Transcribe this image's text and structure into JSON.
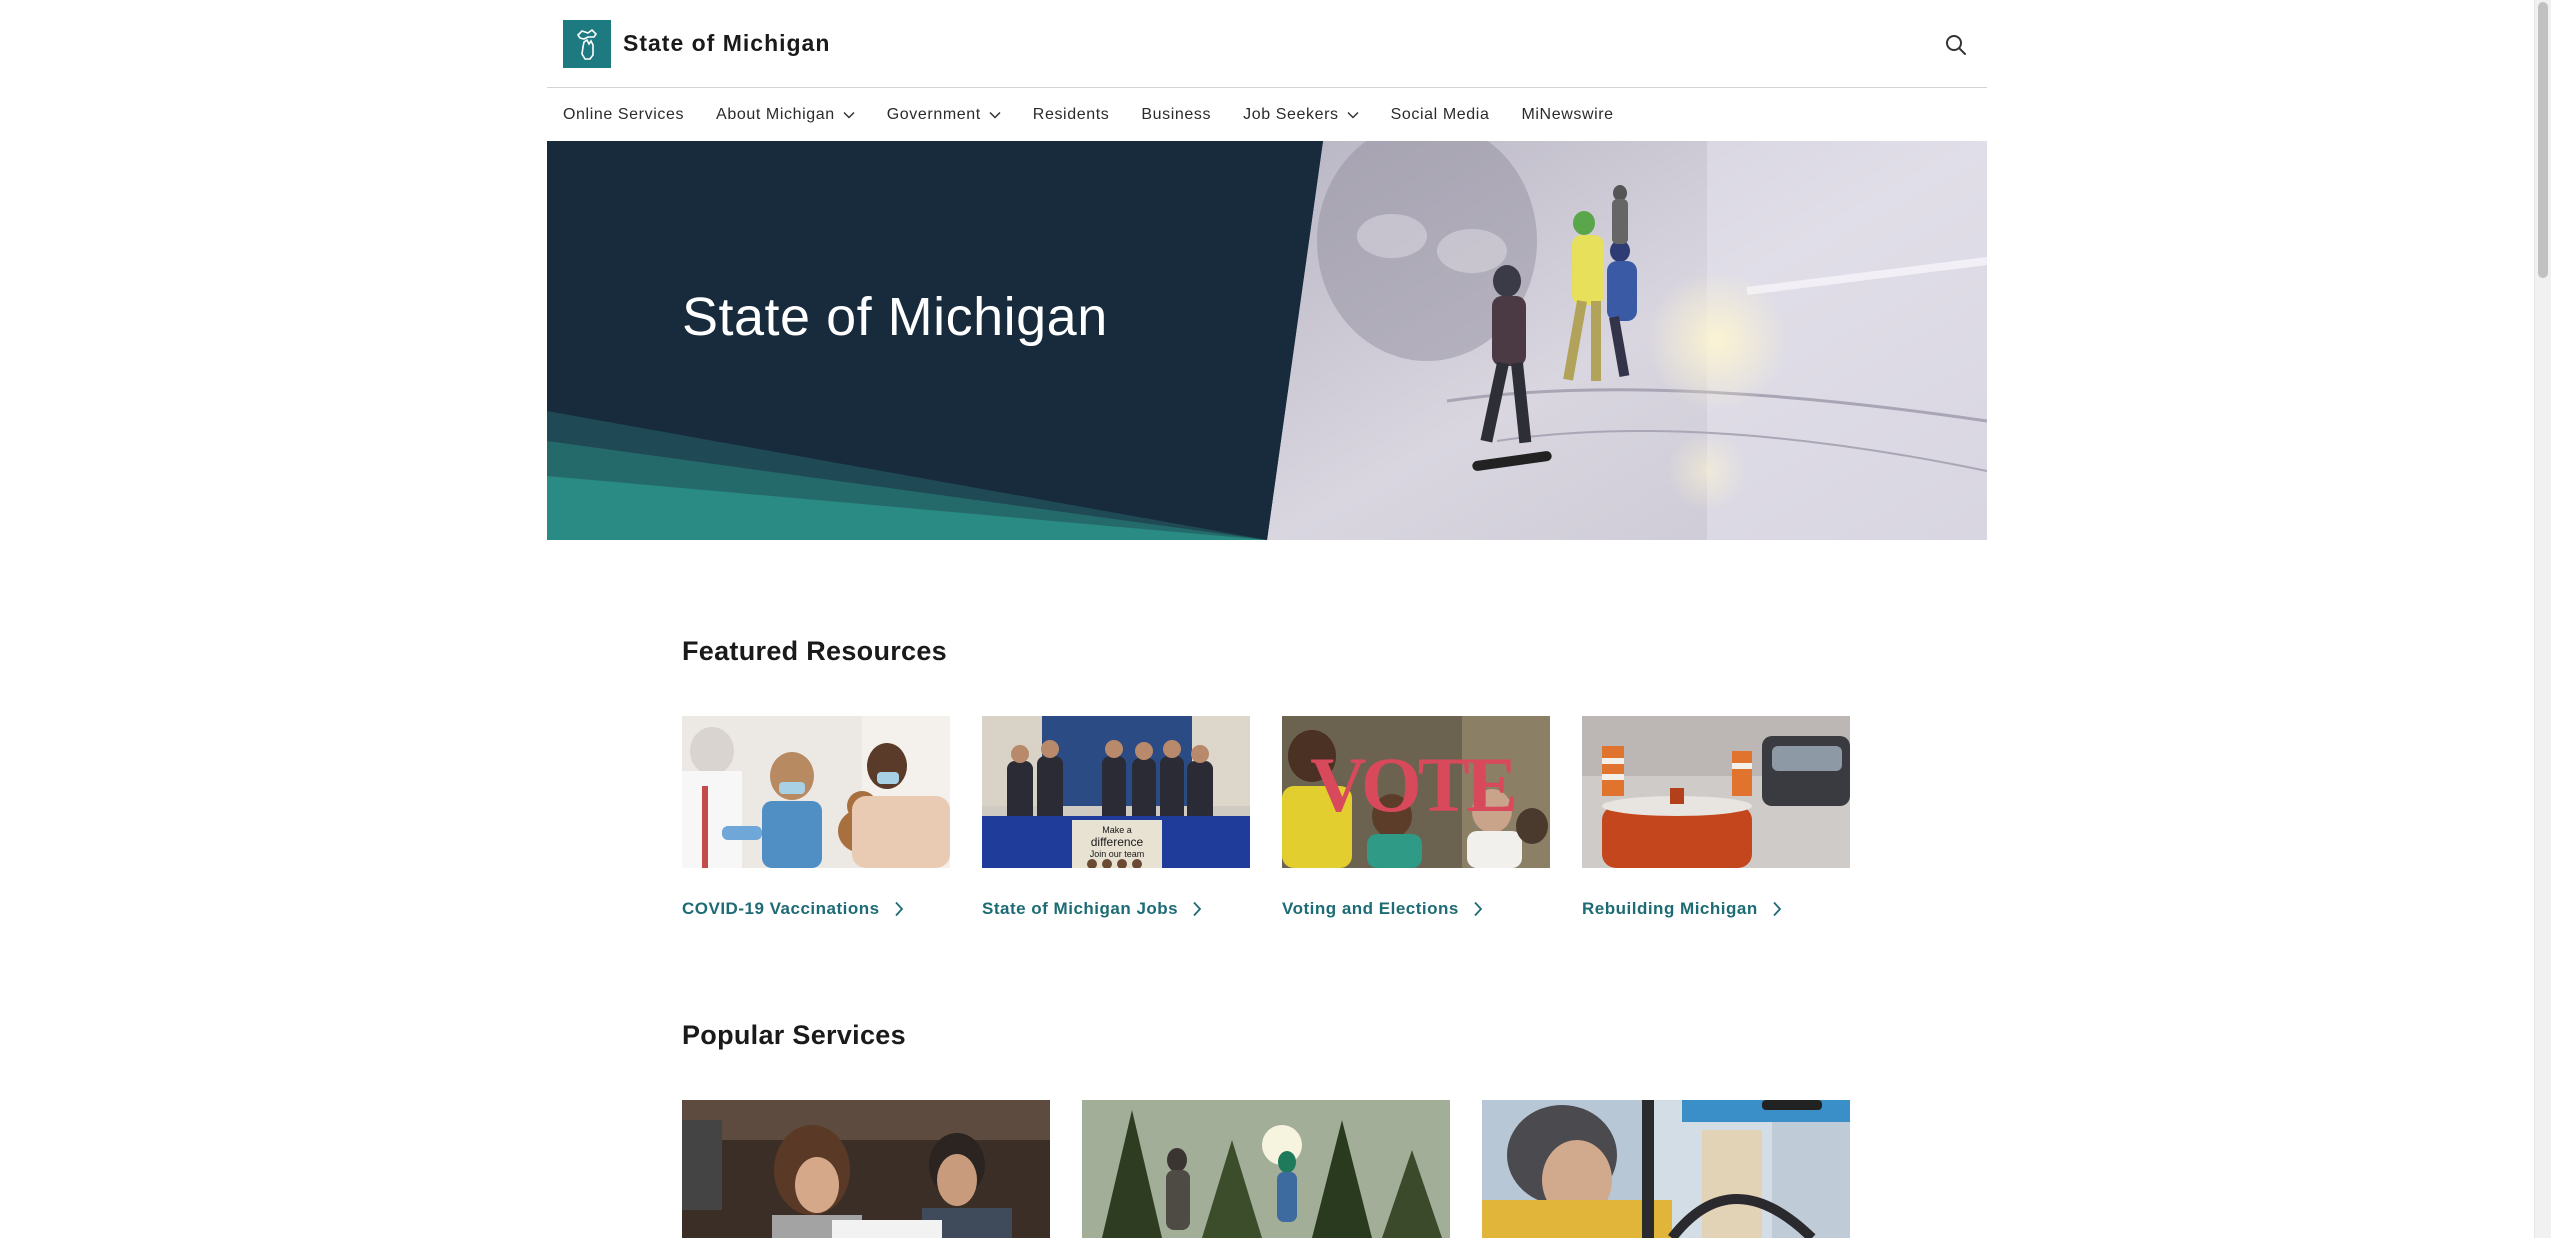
{
  "header": {
    "site_title": "State of Michigan",
    "logo_icon": "michigan-state-logo",
    "search_icon": "search-icon"
  },
  "nav": {
    "items": [
      {
        "label": "Online Services",
        "dropdown": false
      },
      {
        "label": "About Michigan",
        "dropdown": true
      },
      {
        "label": "Government",
        "dropdown": true
      },
      {
        "label": "Residents",
        "dropdown": false
      },
      {
        "label": "Business",
        "dropdown": false
      },
      {
        "label": "Job Seekers",
        "dropdown": true
      },
      {
        "label": "Social Media",
        "dropdown": false
      },
      {
        "label": "MiNewswire",
        "dropdown": false
      }
    ]
  },
  "hero": {
    "title": "State of Michigan"
  },
  "featured": {
    "title": "Featured Resources",
    "cards": [
      {
        "label": "COVID-19 Vaccinations",
        "icon": "chevron-right-icon"
      },
      {
        "label": "State of Michigan Jobs",
        "icon": "chevron-right-icon",
        "sign_text": [
          "Make a",
          "difference",
          "Join our team"
        ]
      },
      {
        "label": "Voting and Elections",
        "icon": "chevron-right-icon",
        "sign_text": "VOTE"
      },
      {
        "label": "Rebuilding Michigan",
        "icon": "chevron-right-icon"
      }
    ]
  },
  "popular": {
    "title": "Popular Services"
  },
  "colors": {
    "brand_teal": "#1d7a80",
    "link_teal": "#1d6b74",
    "hero_navy": "#172b3c",
    "hero_accent": "#2a8a84"
  }
}
